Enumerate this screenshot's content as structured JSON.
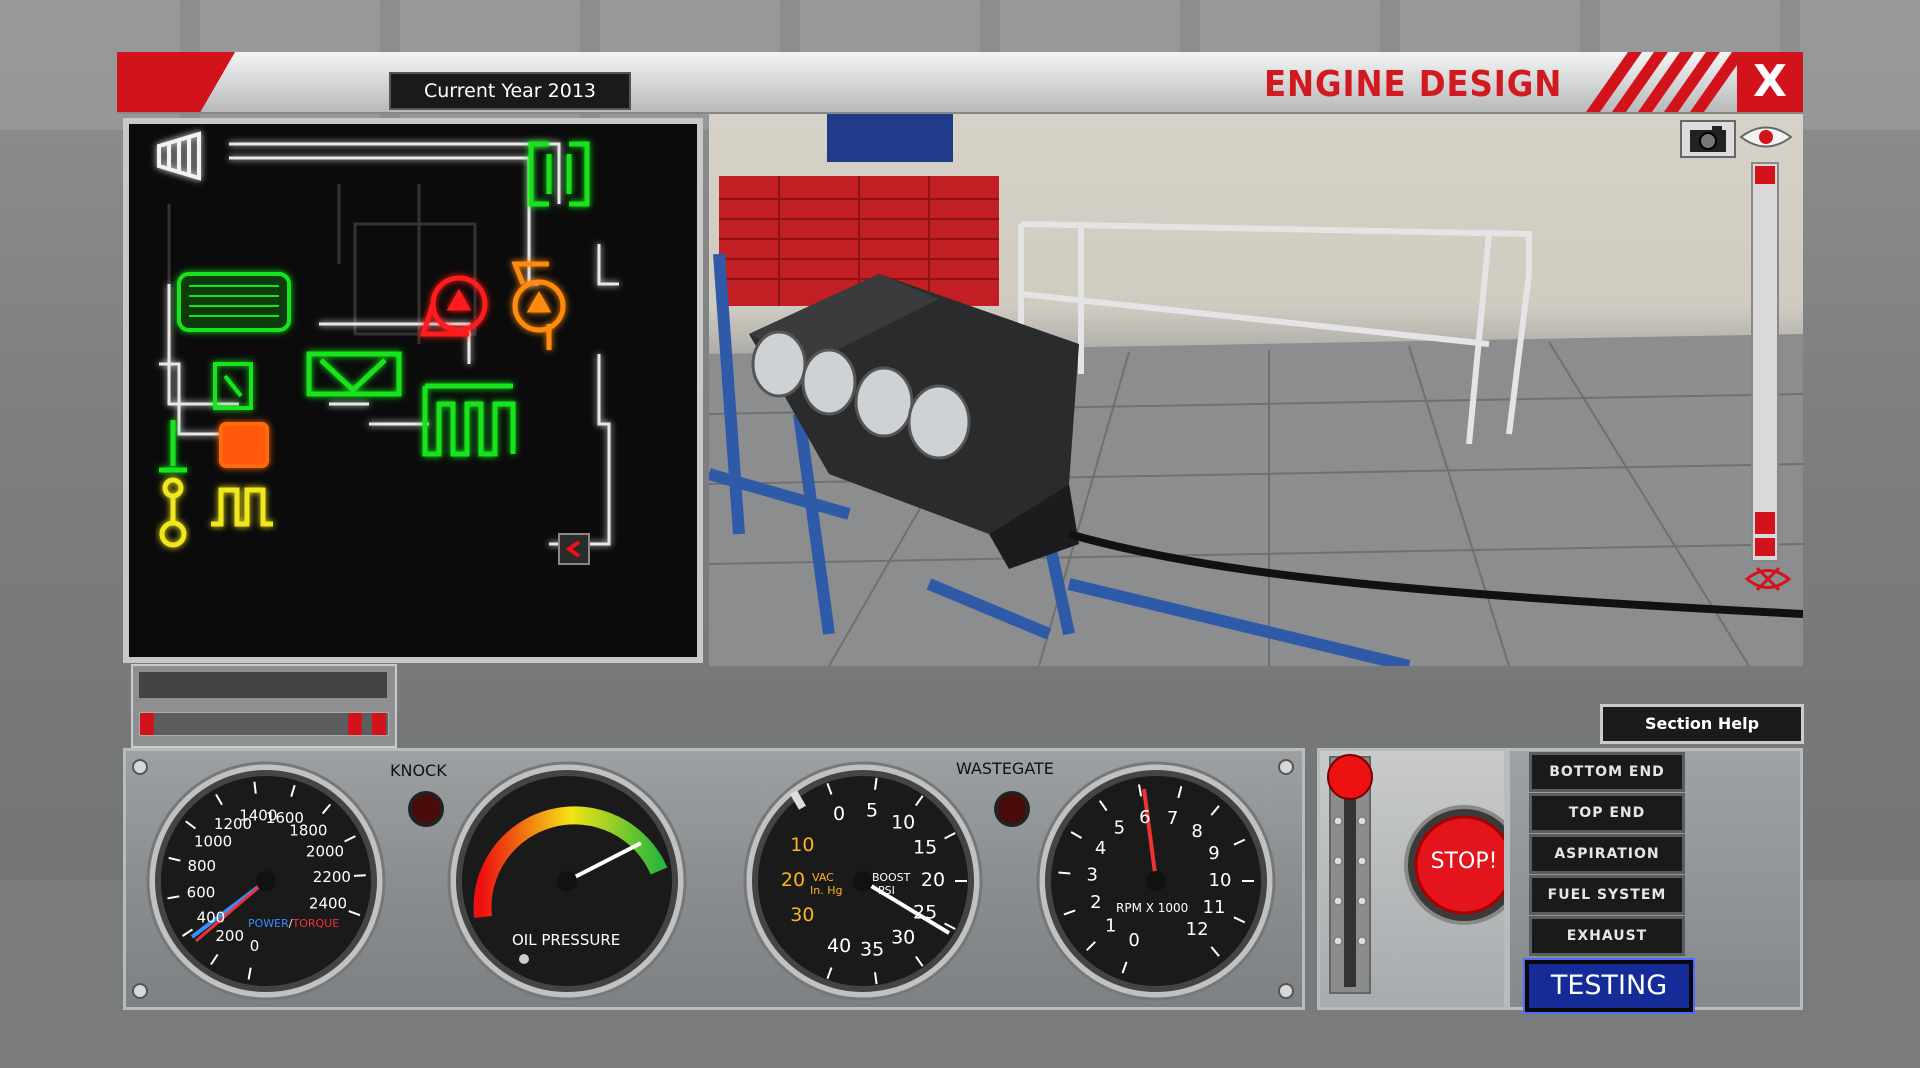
{
  "header": {
    "current_year": "Current Year 2013",
    "title": "ENGINE DESIGN",
    "close_label": "X"
  },
  "section_help": "Section Help",
  "dashboard": {
    "knock_label": "KNOCK",
    "wastegate_label": "WASTEGATE",
    "oil_pressure_label": "OIL PRESSURE",
    "power_label": "POWER",
    "torque_label": "TORQUE",
    "vac_label": "VAC",
    "inhg_label": "In. Hg",
    "boost_label": "BOOST",
    "psi_label": "PSI",
    "rpm_label": "RPM X 1000",
    "stop_label": "STOP!",
    "power_ticks": [
      "0",
      "200",
      "400",
      "600",
      "800",
      "1000",
      "1200",
      "1400",
      "1600",
      "1800",
      "2000",
      "2200",
      "2400"
    ],
    "vac_ticks": [
      "30",
      "20",
      "10"
    ],
    "boost_ticks": [
      "0",
      "5",
      "10",
      "15",
      "20",
      "25",
      "30",
      "35",
      "40"
    ],
    "rpm_ticks": [
      "0",
      "1",
      "2",
      "3",
      "4",
      "5",
      "6",
      "7",
      "8",
      "9",
      "10",
      "11",
      "12"
    ]
  },
  "section_buttons": [
    {
      "label": "BOTTOM END"
    },
    {
      "label": "TOP END"
    },
    {
      "label": "ASPIRATION"
    },
    {
      "label": "FUEL SYSTEM"
    },
    {
      "label": "EXHAUST"
    }
  ],
  "testing_button": "TESTING",
  "colors": {
    "accent_red": "#d3131b",
    "schematic_green": "#18e51f",
    "schematic_red": "#ff1a1a",
    "schematic_orange": "#ff8a10",
    "schematic_yellow": "#f0e81a",
    "testing_blue": "#152b97"
  },
  "icons": {
    "camera": "camera-icon",
    "eye": "eye-icon",
    "collapse": "chevron-left-icon"
  }
}
